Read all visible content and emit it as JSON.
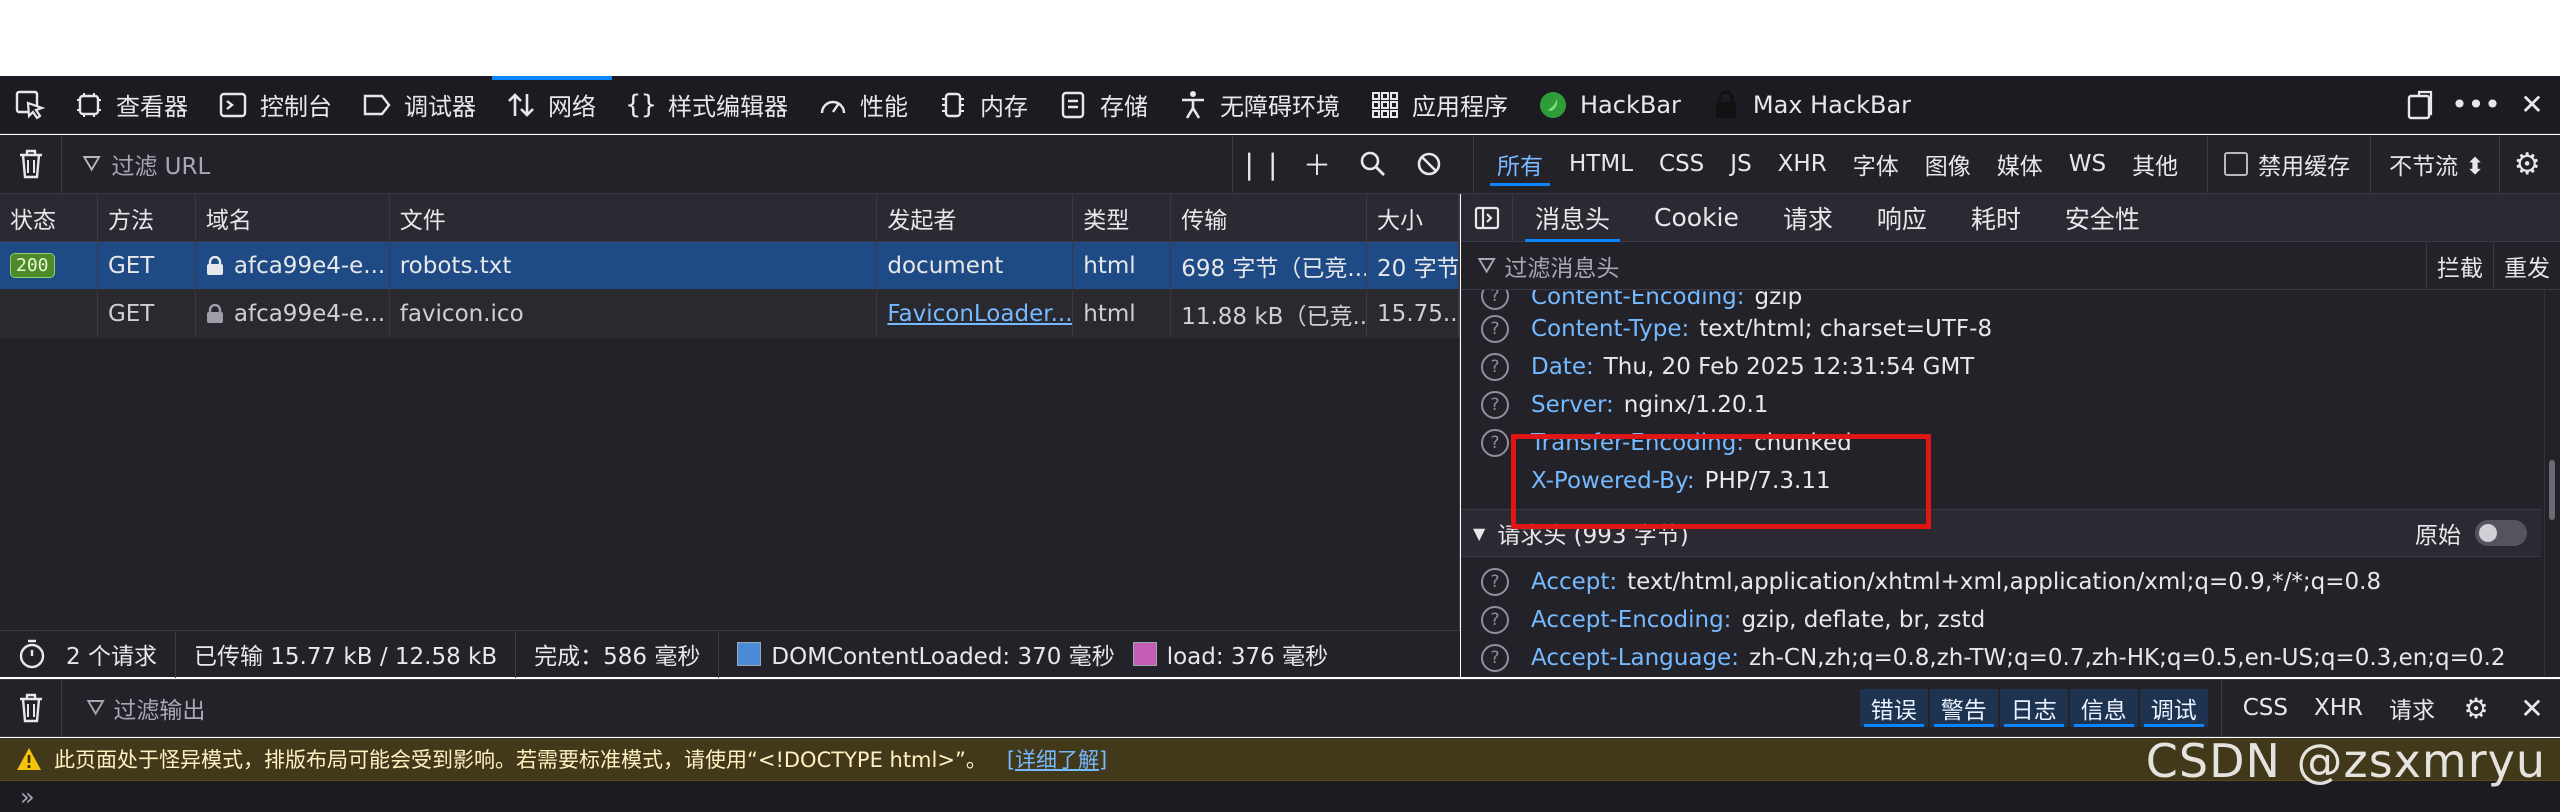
{
  "devtools": {
    "tabs": [
      {
        "label": "查看器",
        "icon": "inspector-icon"
      },
      {
        "label": "控制台",
        "icon": "console-icon"
      },
      {
        "label": "调试器",
        "icon": "debugger-icon"
      },
      {
        "label": "网络",
        "icon": "network-icon",
        "active": true
      },
      {
        "label": "样式编辑器",
        "icon": "style-editor-icon"
      },
      {
        "label": "性能",
        "icon": "performance-icon"
      },
      {
        "label": "内存",
        "icon": "memory-icon"
      },
      {
        "label": "存储",
        "icon": "storage-icon"
      },
      {
        "label": "无障碍环境",
        "icon": "accessibility-icon"
      },
      {
        "label": "应用程序",
        "icon": "application-icon"
      },
      {
        "label": "HackBar",
        "icon": "hackbar-icon"
      },
      {
        "label": "Max HackBar",
        "icon": "max-hackbar-icon"
      }
    ]
  },
  "network": {
    "filter_placeholder": "过滤 URL",
    "type_filters": [
      "所有",
      "HTML",
      "CSS",
      "JS",
      "XHR",
      "字体",
      "图像",
      "媒体",
      "WS",
      "其他"
    ],
    "disable_cache_label": "禁用缓存",
    "throttle_label": "不节流 ⬍",
    "columns": [
      "状态",
      "方法",
      "域名",
      "文件",
      "发起者",
      "类型",
      "传输",
      "大小"
    ],
    "rows": [
      {
        "status": "200",
        "method": "GET",
        "domain": "afca99e4-e...",
        "file": "robots.txt",
        "initiator": "document",
        "type": "html",
        "transfer": "698 字节（已竞...",
        "size": "20 字节"
      },
      {
        "status": "",
        "method": "GET",
        "domain": "afca99e4-e...",
        "file": "favicon.ico",
        "initiator": "FaviconLoader....",
        "type": "html",
        "transfer": "11.88 kB（已竞...",
        "size": "15.75..."
      }
    ],
    "summary": {
      "requests": "2 个请求",
      "transferred": "已传输 15.77 kB / 12.58 kB",
      "finish": "完成：586 毫秒",
      "dom_content_loaded": "DOMContentLoaded: 370 毫秒",
      "load": "load: 376 毫秒"
    },
    "colors": {
      "dcl": "#4b8bd8",
      "load": "#c75bb8"
    }
  },
  "details": {
    "tabs": [
      "消息头",
      "Cookie",
      "请求",
      "响应",
      "耗时",
      "安全性"
    ],
    "filter_placeholder": "过滤消息头",
    "actions": [
      "拦截",
      "重发"
    ],
    "response_headers": [
      {
        "name": "Content-Encoding:",
        "value": "gzip"
      },
      {
        "name": "Content-Type:",
        "value": "text/html; charset=UTF-8"
      },
      {
        "name": "Date:",
        "value": "Thu, 20 Feb 2025 12:31:54 GMT"
      },
      {
        "name": "Server:",
        "value": "nginx/1.20.1"
      },
      {
        "name": "Transfer-Encoding:",
        "value": "chunked"
      },
      {
        "name": "X-Powered-By:",
        "value": "PHP/7.3.11"
      }
    ],
    "request_section_title": "请求头 (993 字节)",
    "raw_label": "原始",
    "request_headers": [
      {
        "name": "Accept:",
        "value": "text/html,application/xhtml+xml,application/xml;q=0.9,*/*;q=0.8"
      },
      {
        "name": "Accept-Encoding:",
        "value": "gzip, deflate, br, zstd"
      },
      {
        "name": "Accept-Language:",
        "value": "zh-CN,zh;q=0.8,zh-TW;q=0.7,zh-HK;q=0.5,en-US;q=0.3,en;q=0.2"
      }
    ]
  },
  "console": {
    "filter_placeholder": "过滤输出",
    "levels": [
      "错误",
      "警告",
      "日志",
      "信息",
      "调试"
    ],
    "extra": [
      "CSS",
      "XHR",
      "请求"
    ],
    "warning": "此页面处于怪异模式，排版布局可能会受到影响。若需要标准模式，请使用“<!DOCTYPE html>”。",
    "warning_link": "[详细了解]",
    "prompt": "»"
  },
  "watermark": "CSDN @zsxmryu"
}
